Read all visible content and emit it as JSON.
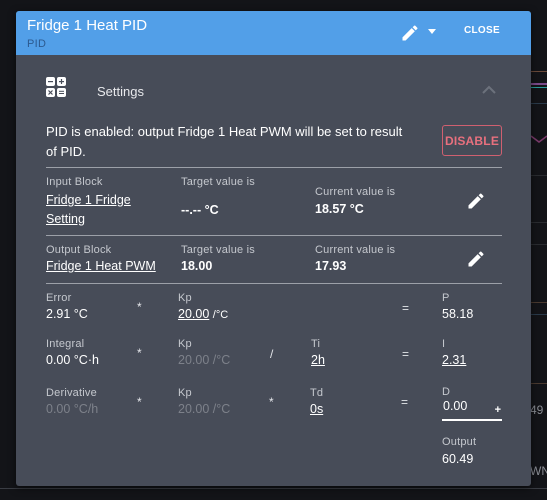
{
  "dialog": {
    "title": "Fridge 1 Heat PID",
    "subtitle": "PID",
    "close_label": "CLOSE",
    "header_color": "#529fe8"
  },
  "section": {
    "icon": "calculator-icon",
    "label": "Settings"
  },
  "status": {
    "message": "PID is enabled: output Fridge 1 Heat PWM will be set to result of PID.",
    "disable_label": "DISABLE",
    "disable_color": "#e8707e"
  },
  "input_block": {
    "label": "Input Block",
    "name": "Fridge 1 Fridge Setting",
    "target_label": "Target value is",
    "target_value": "--.-- °C",
    "current_label": "Current value is",
    "current_value": "18.57 °C"
  },
  "output_block": {
    "label": "Output Block",
    "name": "Fridge 1 Heat PWM",
    "target_label": "Target value is",
    "target_value": "18.00",
    "current_label": "Current value is",
    "current_value": "17.93"
  },
  "calc": {
    "p_row": {
      "term_label": "Error",
      "term_value": "2.91 °C",
      "op1": "*",
      "kp_label": "Kp",
      "kp_value": "20.00",
      "kp_unit": "/°C",
      "eq": "=",
      "result_label": "P",
      "result_value": "58.18"
    },
    "i_row": {
      "term_label": "Integral",
      "term_value": "0.00 °C·h",
      "op1": "*",
      "kp_label": "Kp",
      "kp_value": "20.00 /°C",
      "op2": "/",
      "t_label": "Ti",
      "t_value": "2h",
      "eq": "=",
      "result_label": "I",
      "result_value": "2.31"
    },
    "d_row": {
      "term_label": "Derivative",
      "term_value": "0.00 °C/h",
      "op1": "*",
      "kp_label": "Kp",
      "kp_value": "20.00 /°C",
      "op2": "*",
      "t_label": "Td",
      "t_value": "0s",
      "eq": "=",
      "result_label": "D",
      "result_value": "0.00",
      "plus": "+"
    },
    "output_label": "Output",
    "output_value": "60.49"
  },
  "background": {
    "fragment_1": "49",
    "fragment_2": "WN"
  }
}
